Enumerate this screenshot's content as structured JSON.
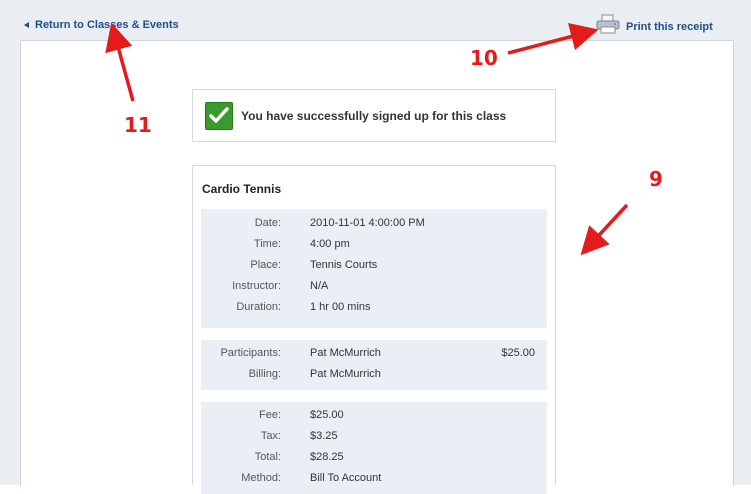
{
  "topbar": {
    "back_label": "Return to Classes & Events",
    "print_label": "Print this receipt"
  },
  "success": {
    "message": "You have successfully signed up for this class"
  },
  "receipt": {
    "title": "Cardio Tennis",
    "details": [
      {
        "key": "Date:",
        "value": "2010-11-01 4:00:00 PM"
      },
      {
        "key": "Time:",
        "value": "4:00 pm"
      },
      {
        "key": "Place:",
        "value": "Tennis Courts"
      },
      {
        "key": "Instructor:",
        "value": "N/A"
      },
      {
        "key": "Duration:",
        "value": "1 hr 00 mins"
      }
    ],
    "participants": [
      {
        "key": "Participants:",
        "value": "Pat McMurrich",
        "amount": "$25.00"
      },
      {
        "key": "Billing:",
        "value": "Pat McMurrich",
        "amount": ""
      }
    ],
    "payment": [
      {
        "key": "Fee:",
        "value": "$25.00"
      },
      {
        "key": "Tax:",
        "value": "$3.25"
      },
      {
        "key": "Total:",
        "value": "$28.25"
      },
      {
        "key": "Method:",
        "value": "Bill To Account"
      }
    ]
  },
  "annotations": {
    "n9": "9",
    "n10": "10",
    "n11": "11"
  },
  "colors": {
    "link": "#1f4e8c",
    "annotation": "#e41b1b",
    "block_bg": "#e9eff5"
  },
  "icons": {
    "back": "triangle-left-icon",
    "print": "printer-icon",
    "success": "checkmark-icon"
  }
}
